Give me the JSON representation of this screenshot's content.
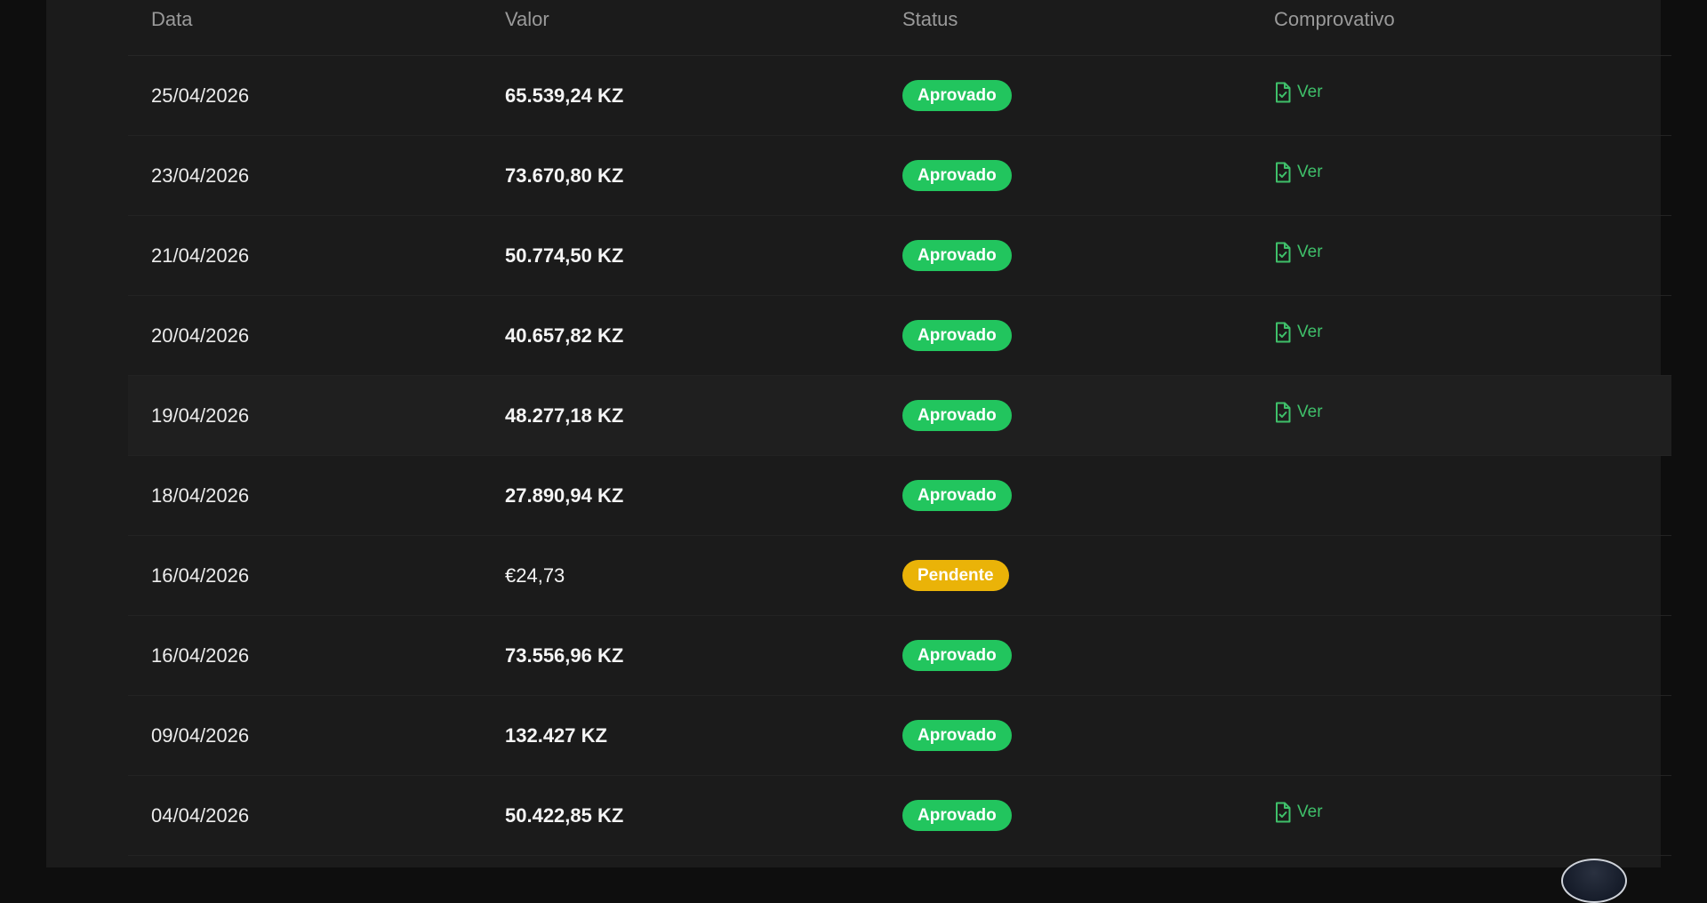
{
  "table": {
    "headers": {
      "date": "Data",
      "value": "Valor",
      "status": "Status",
      "receipt": "Comprovativo"
    },
    "rows": [
      {
        "date": "25/04/2026",
        "value": "65.539,24 KZ",
        "status": "Aprovado",
        "receipt": "Ver"
      },
      {
        "date": "23/04/2026",
        "value": "73.670,80 KZ",
        "status": "Aprovado",
        "receipt": "Ver"
      },
      {
        "date": "21/04/2026",
        "value": "50.774,50 KZ",
        "status": "Aprovado",
        "receipt": "Ver"
      },
      {
        "date": "20/04/2026",
        "value": "40.657,82 KZ",
        "status": "Aprovado",
        "receipt": "Ver"
      },
      {
        "date": "19/04/2026",
        "value": "48.277,18 KZ",
        "status": "Aprovado",
        "receipt": "Ver"
      },
      {
        "date": "18/04/2026",
        "value": "27.890,94 KZ",
        "status": "Aprovado",
        "receipt": ""
      },
      {
        "date": "16/04/2026",
        "value": "€24,73",
        "status": "Pendente",
        "receipt": ""
      },
      {
        "date": "16/04/2026",
        "value": "73.556,96 KZ",
        "status": "Aprovado",
        "receipt": ""
      },
      {
        "date": "09/04/2026",
        "value": "132.427 KZ",
        "status": "Aprovado",
        "receipt": ""
      },
      {
        "date": "04/04/2026",
        "value": "50.422,85 KZ",
        "status": "Aprovado",
        "receipt": "Ver"
      }
    ]
  },
  "colors": {
    "panel_background": "#1b1b1b",
    "approved": "#22c55e",
    "pending": "#eab308",
    "receipt_link": "#3fc06a"
  },
  "icons": {
    "receipt": "file-check-icon"
  }
}
